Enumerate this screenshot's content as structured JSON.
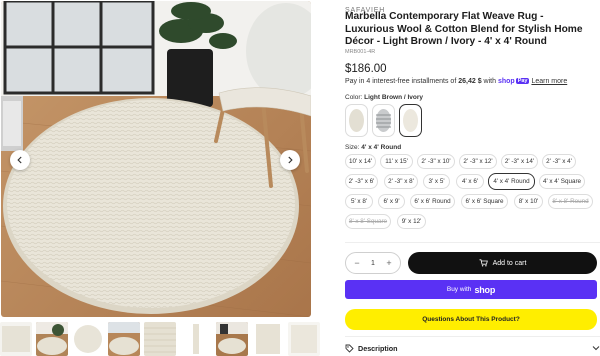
{
  "gallery": {
    "prev_icon": "chevron-left-icon",
    "next_icon": "chevron-right-icon",
    "thumbnails": [
      "thumb-1",
      "thumb-2",
      "thumb-3",
      "thumb-4",
      "thumb-5",
      "thumb-6",
      "thumb-7",
      "thumb-8",
      "thumb-9"
    ]
  },
  "product": {
    "brand": "SAFAVIEH",
    "title": "Marbella Contemporary Flat Weave Rug - Luxurious Wool & Cotton Blend for Stylish Home Décor - Light Brown / Ivory - 4' x 4' Round",
    "sku": "MRB001-4R",
    "price": "$186.00"
  },
  "installments": {
    "prefix": "Pay in 4 interest-free installments of",
    "amount": "26,42 $",
    "with": "with",
    "shop_word": "shop",
    "pay_badge": "Pay",
    "learn_more": "Learn more"
  },
  "color": {
    "label": "Color:",
    "selected": "Light Brown / Ivory",
    "swatch_names": [
      "swatch-ivory-round",
      "swatch-grey-stripe",
      "swatch-light-brown-ivory"
    ]
  },
  "size": {
    "label": "Size:",
    "selected": "4' x 4' Round",
    "options": [
      {
        "label": "10' x 14'"
      },
      {
        "label": "11' x 15'"
      },
      {
        "label": "2' -3\" x 10'"
      },
      {
        "label": "2' -3\" x 12'"
      },
      {
        "label": "2' -3\" x 14'"
      },
      {
        "label": "2' -3\" x 4'"
      },
      {
        "label": "2' -3\" x 6'"
      },
      {
        "label": "2' -3\" x 8'"
      },
      {
        "label": "3' x 5'"
      },
      {
        "label": "4' x 6'"
      },
      {
        "label": "4' x 4' Round"
      },
      {
        "label": "4' x 4' Square"
      },
      {
        "label": "5' x 8'"
      },
      {
        "label": "6' x 9'"
      },
      {
        "label": "6' x 6' Round"
      },
      {
        "label": "6' x 6' Square"
      },
      {
        "label": "8' x 10'"
      },
      {
        "label": "8' x 8' Round"
      },
      {
        "label": "8' x 8' Square"
      },
      {
        "label": "9' x 12'"
      }
    ]
  },
  "quantity": {
    "minus": "−",
    "value": "1",
    "plus": "+"
  },
  "buttons": {
    "add_to_cart": "Add to cart",
    "buy_with": "Buy with",
    "shop_logo": "shop",
    "questions": "Questions About This Product?"
  },
  "accordion": {
    "description": "Description"
  },
  "colors": {
    "accent_dark": "#111111",
    "shop_purple": "#5a31f4",
    "question_yellow": "#ffee00"
  }
}
